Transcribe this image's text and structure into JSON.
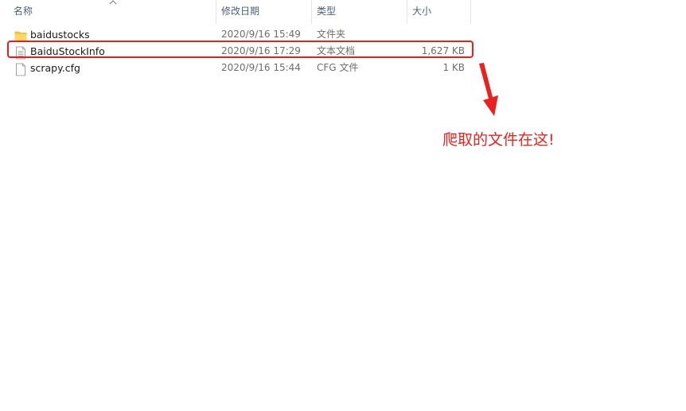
{
  "columns": {
    "name": "名称",
    "date": "修改日期",
    "type": "类型",
    "size": "大小"
  },
  "files": [
    {
      "name": "baidustocks",
      "date": "2020/9/16 15:49",
      "type": "文件夹",
      "size": "",
      "icon": "folder-icon"
    },
    {
      "name": "BaiduStockInfo",
      "date": "2020/9/16 17:29",
      "type": "文本文档",
      "size": "1,627 KB",
      "icon": "text-document-icon"
    },
    {
      "name": "scrapy.cfg",
      "date": "2020/9/16 15:44",
      "type": "CFG 文件",
      "size": "1 KB",
      "icon": "blank-file-icon"
    }
  ],
  "annotation": {
    "text": "爬取的文件在这!",
    "color": "#e8231f"
  },
  "colors": {
    "highlight": "#f01c1c",
    "folder": "#f5c542",
    "header_text": "#4c607a"
  }
}
